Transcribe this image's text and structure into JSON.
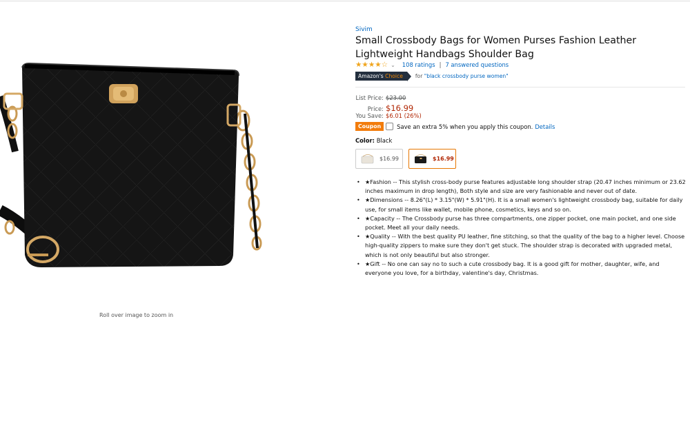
{
  "product": {
    "brand": "Sivim",
    "title": "Small Crossbody Bags for Women Purses Fashion Leather Lightweight Handbags Shoulder Bag",
    "rating_value": 4.5,
    "stars": "★★★★☆",
    "ratings_count": "108 ratings",
    "separator": "|",
    "answered_questions": "7 answered questions",
    "choice_badge_prefix": "Amazon's",
    "choice_badge_suffix": "Choice",
    "choice_for_prefix": "for",
    "choice_for_query": "\"black crossbody purse women\""
  },
  "pricing": {
    "list_label": "List Price:",
    "list_value": "$23.00",
    "price_label": "Price:",
    "price_value": "$16.99",
    "save_label": "You Save:",
    "save_value": "$6.01 (26%)",
    "coupon_badge": "Coupon",
    "coupon_text": "Save an extra 5% when you apply this coupon.",
    "coupon_link": "Details"
  },
  "color": {
    "label": "Color:",
    "selected": "Black",
    "options": [
      {
        "name": "White",
        "price": "$16.99",
        "selected": false
      },
      {
        "name": "Black",
        "price": "$16.99",
        "selected": true
      }
    ]
  },
  "features": [
    "★Fashion -- This stylish cross-body purse features adjustable long shoulder strap (20.47 inches minimum or 23.62 inches maximum in drop length), Both style and size are very fashionable and never out of date.",
    "★Dimensions -- 8.26\"(L) * 3.15\"(W) * 5.91\"(H). It is a small women's lightweight crossbody bag, suitable for daily use, for small items like wallet, mobile phone, cosmetics, keys and so on.",
    "★Capacity -- The Crossbody purse has three compartments, one zipper pocket, one main pocket, and one side pocket. Meet all your daily needs.",
    "★Quality -- With the best quality PU leather, fine stitching, so that the quality of the bag to a higher level. Choose high-quality zippers to make sure they don't get stuck. The shoulder strap is decorated with upgraded metal, which is not only beautiful but also stronger.",
    "★Gift -- No one can say no to such a cute crossbody bag. It is a good gift for mother, daughter, wife, and everyone you love, for a birthday, valentine's day, Christmas."
  ],
  "image": {
    "zoom_hint": "Roll over image to zoom in"
  },
  "colors": {
    "link": "#0066c0",
    "price": "#b12704",
    "coupon": "#f27c0c",
    "star": "#f0a41b",
    "badge_dark": "#232f3e"
  }
}
